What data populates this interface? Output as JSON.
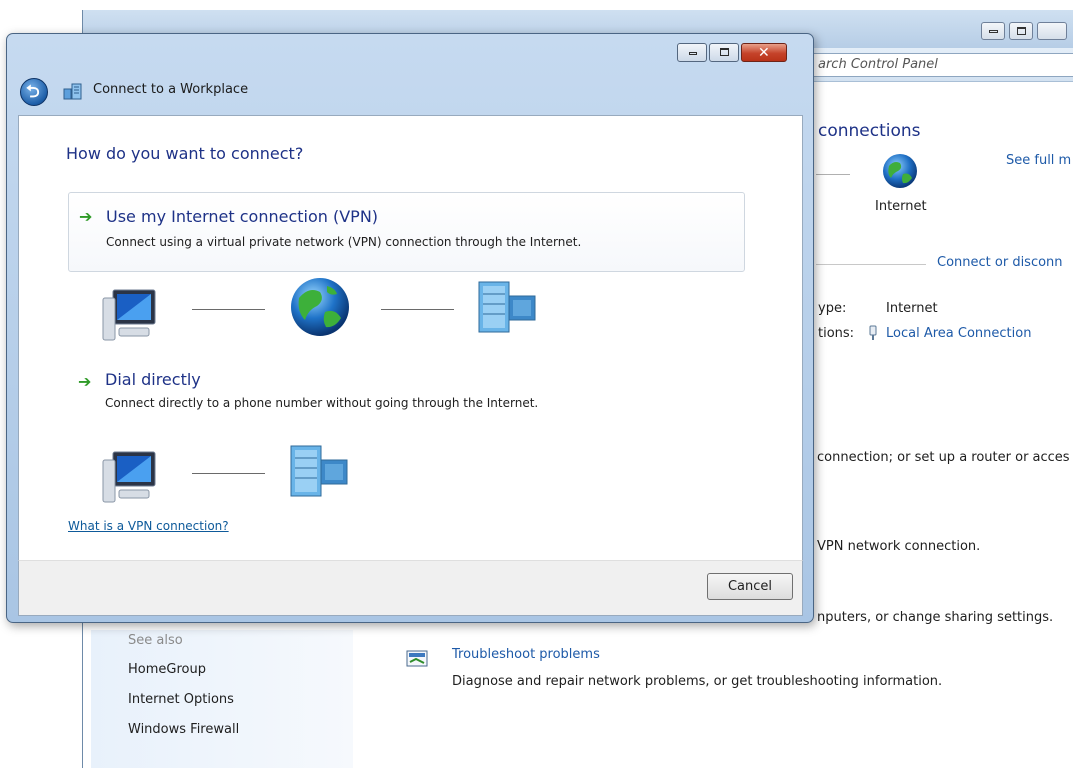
{
  "background_window": {
    "search_placeholder": "arch Control Panel",
    "heading": "connections",
    "see_full_map": "See full m",
    "internet_label": "Internet",
    "connect_or_disconnect": "Connect or disconn",
    "access_type_label": "ype:",
    "access_type_value": "Internet",
    "connections_label": "tions:",
    "connection_value": "Local Area Connection",
    "tasks": [
      {
        "text": "connection; or set up a router or acces"
      },
      {
        "text": "VPN network connection."
      },
      {
        "text": "nputers, or change sharing settings."
      }
    ],
    "troubleshoot": {
      "title": "Troubleshoot problems",
      "description": "Diagnose and repair network problems, or get troubleshooting information."
    },
    "see_also": {
      "heading": "See also",
      "links": [
        "HomeGroup",
        "Internet Options",
        "Windows Firewall"
      ]
    }
  },
  "dialog": {
    "title": "Connect to a Workplace",
    "close_glyph": "✕",
    "back_glyph": "⮌",
    "question": "How do you want to connect?",
    "options": [
      {
        "arrow": "➔",
        "title": "Use my Internet connection (VPN)",
        "description": "Connect using a virtual private network (VPN) connection through the Internet."
      },
      {
        "arrow": "➔",
        "title": "Dial directly",
        "description": "Connect directly to a phone number without going through the Internet."
      }
    ],
    "help_link": "What is a VPN connection?",
    "cancel_label": "Cancel"
  },
  "colors": {
    "heading_blue": "#1e3287",
    "link_blue": "#1e5aa8",
    "arrow_green": "#2f9b28",
    "chrome_blue": "#b6cde6"
  },
  "icons": [
    "back-arrow-icon",
    "workplace-network-icon",
    "computer-icon",
    "globe-icon",
    "office-building-icon",
    "network-plug-icon",
    "troubleshoot-icon"
  ]
}
